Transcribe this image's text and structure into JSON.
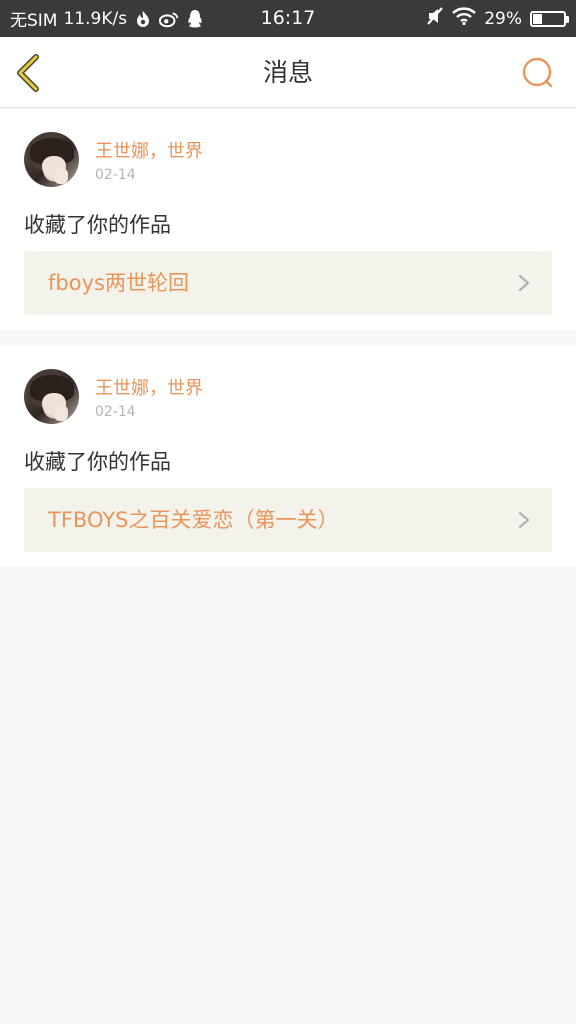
{
  "status_bar": {
    "carrier": "无SIM",
    "speed": "11.9K/s",
    "time": "16:17",
    "battery": "29%",
    "battery_level": 0.29,
    "icons": [
      "flame-icon",
      "weibo-icon",
      "qq-icon",
      "mute-icon",
      "wifi-icon",
      "battery-icon"
    ]
  },
  "nav": {
    "title": "消息",
    "back_icon": "chevron-left-icon",
    "search_icon": "search-icon"
  },
  "colors": {
    "accent": "#e9955a",
    "back_icon": "#e6c93a",
    "status_bar_bg": "#3a3a3a",
    "work_bg": "#f3f3ec",
    "page_bg": "#f7f7f7"
  },
  "messages": [
    {
      "user": "王世娜，世界",
      "date": "02-14",
      "action": "收藏了你的作品",
      "work": "fboys两世轮回"
    },
    {
      "user": "王世娜，世界",
      "date": "02-14",
      "action": "收藏了你的作品",
      "work": "TFBOYS之百关爱恋（第一关）"
    }
  ]
}
